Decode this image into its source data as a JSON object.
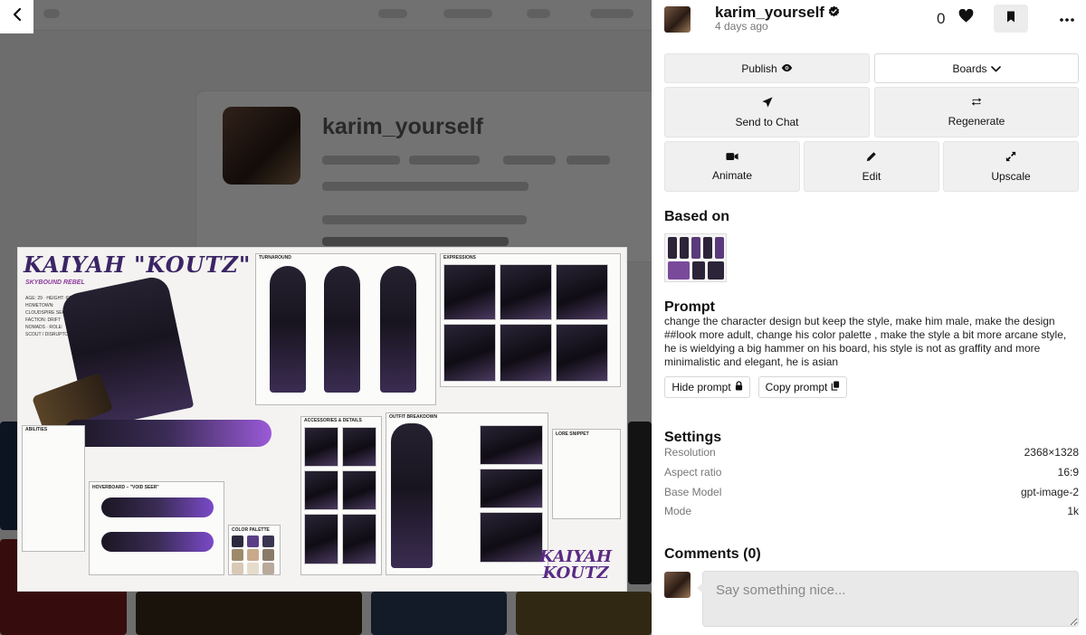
{
  "background": {
    "profile_name": "karim_yourself"
  },
  "artwork": {
    "title": "KAIYAH \"KOUTZ\"",
    "subtitle": "SKYBOUND REBEL",
    "stats": "AGE: 29 · HEIGHT: 6'0\" · HOMETOWN: CLOUDSPIRE SECTOR · FACTION: DRIFT NOMADS · ROLE: SCOUT / DISRUPTOR",
    "turnaround_label": "TURNAROUND",
    "expressions_label": "EXPRESSIONS",
    "abilities_label": "ABILITIES",
    "accessories_label": "ACCESSORIES & DETAILS",
    "outfit_label": "OUTFIT BREAKDOWN",
    "lore_label": "LORE SNIPPET",
    "hoverboard_label": "HOVERBOARD – \"VOID SEER\"",
    "palette_label": "COLOR PALETTE",
    "logo_line1": "KAIYAH",
    "logo_line2": "KOUTZ",
    "palette": [
      "#2d2a3e",
      "#5b3f86",
      "#3a3550",
      "#9e8a6a",
      "#c9a98a",
      "#8a7a6a",
      "#d8c9b6",
      "#e6dccc",
      "#b8a99a"
    ]
  },
  "header": {
    "username": "karim_yourself",
    "time_ago": "4 days ago",
    "like_count": "0"
  },
  "actions": {
    "publish": "Publish",
    "boards": "Boards",
    "send_to_chat": "Send to Chat",
    "regenerate": "Regenerate",
    "animate": "Animate",
    "edit": "Edit",
    "upscale": "Upscale"
  },
  "based_on": {
    "title": "Based on"
  },
  "prompt": {
    "title": "Prompt",
    "text": "change the character design but keep the style, make him male, make the design ##look more adult, change his color palette , make the style a bit more arcane style, he is wieldying a big hammer on his board, his style is not as graffity and more minimalistic and elegant, he is asian",
    "hide_label": "Hide prompt",
    "copy_label": "Copy prompt"
  },
  "settings": {
    "title": "Settings",
    "rows": [
      {
        "key": "Resolution",
        "value": "2368×1328"
      },
      {
        "key": "Aspect ratio",
        "value": "16:9"
      },
      {
        "key": "Base Model",
        "value": "gpt-image-2"
      },
      {
        "key": "Mode",
        "value": "1k"
      }
    ]
  },
  "comments": {
    "title": "Comments (0)",
    "placeholder": "Say something nice..."
  },
  "colors": {
    "accent_purple": "#5a2a83",
    "button_bg": "#f0f0f0"
  }
}
